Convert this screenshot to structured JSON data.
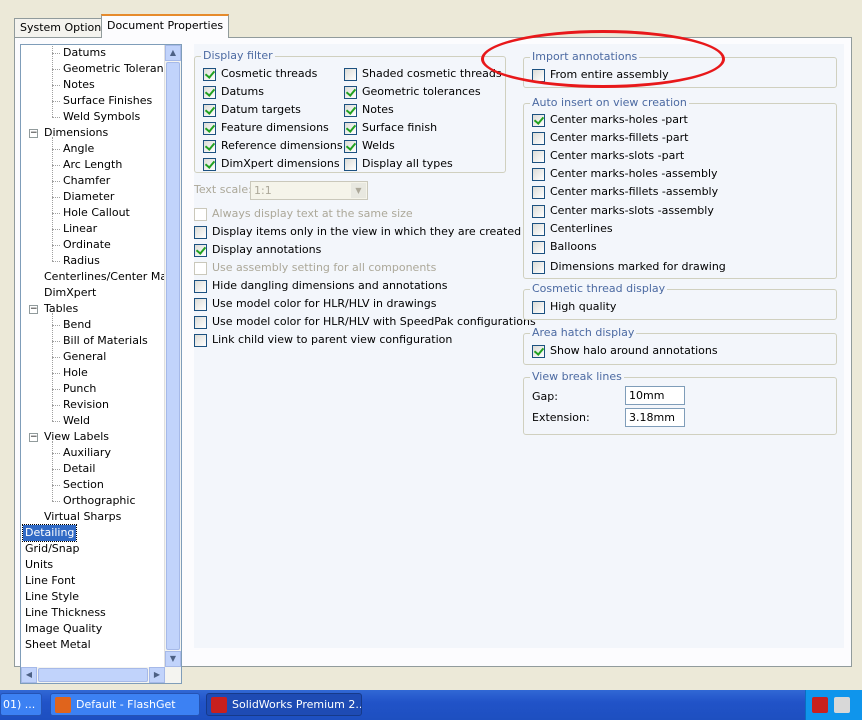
{
  "tabs": [
    {
      "label": "System Options",
      "active": false
    },
    {
      "label": "Document Properties",
      "active": true
    }
  ],
  "tree": {
    "items": [
      {
        "label": "Datums",
        "level": 2
      },
      {
        "label": "Geometric Tolerances",
        "level": 2
      },
      {
        "label": "Notes",
        "level": 2
      },
      {
        "label": "Surface Finishes",
        "level": 2
      },
      {
        "label": "Weld Symbols",
        "level": 2
      },
      {
        "label": "Dimensions",
        "level": 1,
        "expander": "−"
      },
      {
        "label": "Angle",
        "level": 2
      },
      {
        "label": "Arc Length",
        "level": 2
      },
      {
        "label": "Chamfer",
        "level": 2
      },
      {
        "label": "Diameter",
        "level": 2
      },
      {
        "label": "Hole Callout",
        "level": 2
      },
      {
        "label": "Linear",
        "level": 2
      },
      {
        "label": "Ordinate",
        "level": 2
      },
      {
        "label": "Radius",
        "level": 2
      },
      {
        "label": "Centerlines/Center Marks",
        "level": 1
      },
      {
        "label": "DimXpert",
        "level": 1
      },
      {
        "label": "Tables",
        "level": 1,
        "expander": "−"
      },
      {
        "label": "Bend",
        "level": 2
      },
      {
        "label": "Bill of Materials",
        "level": 2
      },
      {
        "label": "General",
        "level": 2
      },
      {
        "label": "Hole",
        "level": 2
      },
      {
        "label": "Punch",
        "level": 2
      },
      {
        "label": "Revision",
        "level": 2
      },
      {
        "label": "Weld",
        "level": 2
      },
      {
        "label": "View Labels",
        "level": 1,
        "expander": "−"
      },
      {
        "label": "Auxiliary",
        "level": 2
      },
      {
        "label": "Detail",
        "level": 2
      },
      {
        "label": "Section",
        "level": 2
      },
      {
        "label": "Orthographic",
        "level": 2
      },
      {
        "label": "Virtual Sharps",
        "level": 1
      },
      {
        "label": "Detailing",
        "level": 0,
        "selected": true
      },
      {
        "label": "Grid/Snap",
        "level": 0
      },
      {
        "label": "Units",
        "level": 0
      },
      {
        "label": "Line Font",
        "level": 0
      },
      {
        "label": "Line Style",
        "level": 0
      },
      {
        "label": "Line Thickness",
        "level": 0
      },
      {
        "label": "Image Quality",
        "level": 0
      },
      {
        "label": "Sheet Metal",
        "level": 0
      }
    ]
  },
  "display_filter": {
    "legend": "Display filter",
    "left": [
      {
        "label": "Cosmetic threads",
        "checked": true
      },
      {
        "label": "Datums",
        "checked": true
      },
      {
        "label": "Datum targets",
        "checked": true
      },
      {
        "label": "Feature dimensions",
        "checked": true
      },
      {
        "label": "Reference dimensions",
        "checked": true
      },
      {
        "label": "DimXpert dimensions",
        "checked": true
      }
    ],
    "right": [
      {
        "label": "Shaded cosmetic threads",
        "checked": false
      },
      {
        "label": "Geometric tolerances",
        "checked": true
      },
      {
        "label": "Notes",
        "checked": true
      },
      {
        "label": "Surface finish",
        "checked": true
      },
      {
        "label": "Welds",
        "checked": true
      },
      {
        "label": "Display all types",
        "checked": false
      }
    ]
  },
  "text_scale": {
    "label": "Text scale:",
    "value": "1:1"
  },
  "options": [
    {
      "label": "Always display text at the same size",
      "checked": false,
      "disabled": true
    },
    {
      "label": "Display items only in the view in which they are created",
      "checked": false,
      "disabled": false
    },
    {
      "label": "Display annotations",
      "checked": true,
      "disabled": false
    },
    {
      "label": "Use assembly setting for all components",
      "checked": false,
      "disabled": true
    },
    {
      "label": "Hide dangling dimensions and annotations",
      "checked": false,
      "disabled": false
    },
    {
      "label": "Use model color for HLR/HLV in drawings",
      "checked": false,
      "disabled": false
    },
    {
      "label": "Use model color for HLR/HLV with SpeedPak configurations",
      "checked": false,
      "disabled": false
    },
    {
      "label": "Link child view to parent view configuration",
      "checked": false,
      "disabled": false
    }
  ],
  "import_annotations": {
    "legend": "Import annotations",
    "items": [
      {
        "label": "From entire assembly",
        "checked": false
      }
    ]
  },
  "auto_insert": {
    "legend": "Auto insert on view creation",
    "items": [
      {
        "label": "Center marks-holes -part",
        "checked": true
      },
      {
        "label": "Center marks-fillets -part",
        "checked": false
      },
      {
        "label": "Center marks-slots  -part",
        "checked": false
      },
      {
        "label": "Center marks-holes -assembly",
        "checked": false
      },
      {
        "label": "Center marks-fillets -assembly",
        "checked": false
      },
      {
        "label": "Center marks-slots  -assembly",
        "checked": false
      },
      {
        "label": "Centerlines",
        "checked": false
      },
      {
        "label": "Balloons",
        "checked": false
      },
      {
        "label": "Dimensions marked for drawing",
        "checked": false
      }
    ]
  },
  "cosmetic_thread_display": {
    "legend": "Cosmetic thread display",
    "items": [
      {
        "label": "High quality",
        "checked": false
      }
    ]
  },
  "area_hatch_display": {
    "legend": "Area hatch display",
    "items": [
      {
        "label": "Show halo around annotations",
        "checked": true
      }
    ]
  },
  "view_break_lines": {
    "legend": "View break lines",
    "gap_label": "Gap:",
    "gap_value": "10mm",
    "extension_label": "Extension:",
    "extension_value": "3.18mm"
  },
  "taskbar": {
    "buttons": [
      {
        "label": "01) ..."
      },
      {
        "label": "Default - FlashGet",
        "icon_color": "#e0641c"
      },
      {
        "label": "SolidWorks Premium 2...",
        "icon_color": "#c8201e",
        "active": true
      }
    ]
  },
  "colors": {
    "annotation_circle": "#e8181a",
    "selection": "#316ac5",
    "group_legend": "#4c6aa2"
  }
}
